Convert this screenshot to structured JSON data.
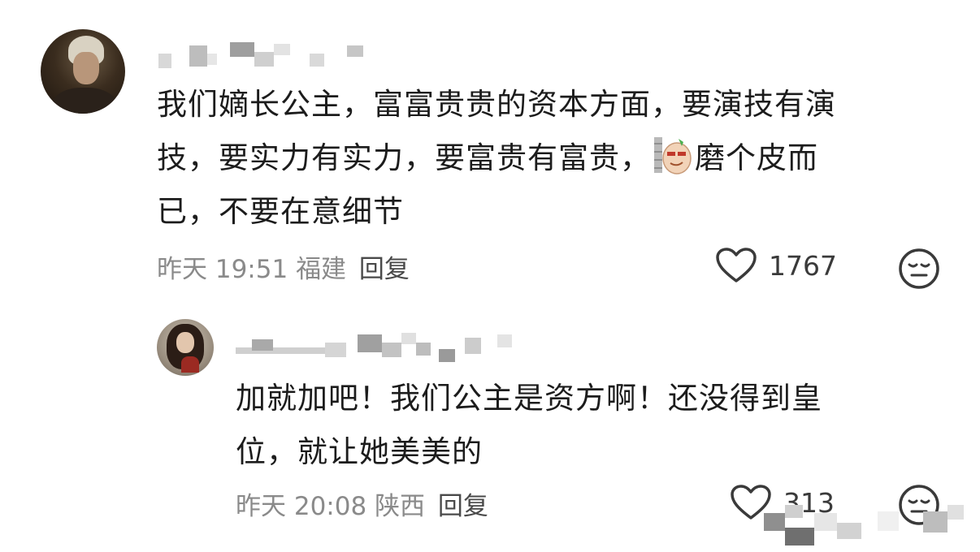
{
  "comments": [
    {
      "text_line1": "我们嫡长公主，富富贵贵的资本方面，要演技有演",
      "text_line2a": "技，要实力有实力，要富贵有富贵，",
      "text_line2b": "磨个皮而",
      "text_line3": "已，不要在意细节",
      "time": "昨天 19:51",
      "location": "福建",
      "reply_label": "回复",
      "likes": "1767",
      "like_icon": "heart-outline-icon",
      "reaction_icon": "expressionless-face-icon",
      "sticker_icon": "smirking-peanut-sticker"
    },
    {
      "text_line1": "加就加吧！我们公主是资方啊！还没得到皇",
      "text_line2": "位，就让她美美的",
      "time": "昨天 20:08",
      "location": "陕西",
      "reply_label": "回复",
      "likes": "313",
      "like_icon": "heart-outline-icon",
      "reaction_icon": "expressionless-face-icon"
    }
  ],
  "colors": {
    "text": "#1c1c1c",
    "meta": "#8a8a8a",
    "icon": "#3a3a3a",
    "background": "#ffffff"
  }
}
